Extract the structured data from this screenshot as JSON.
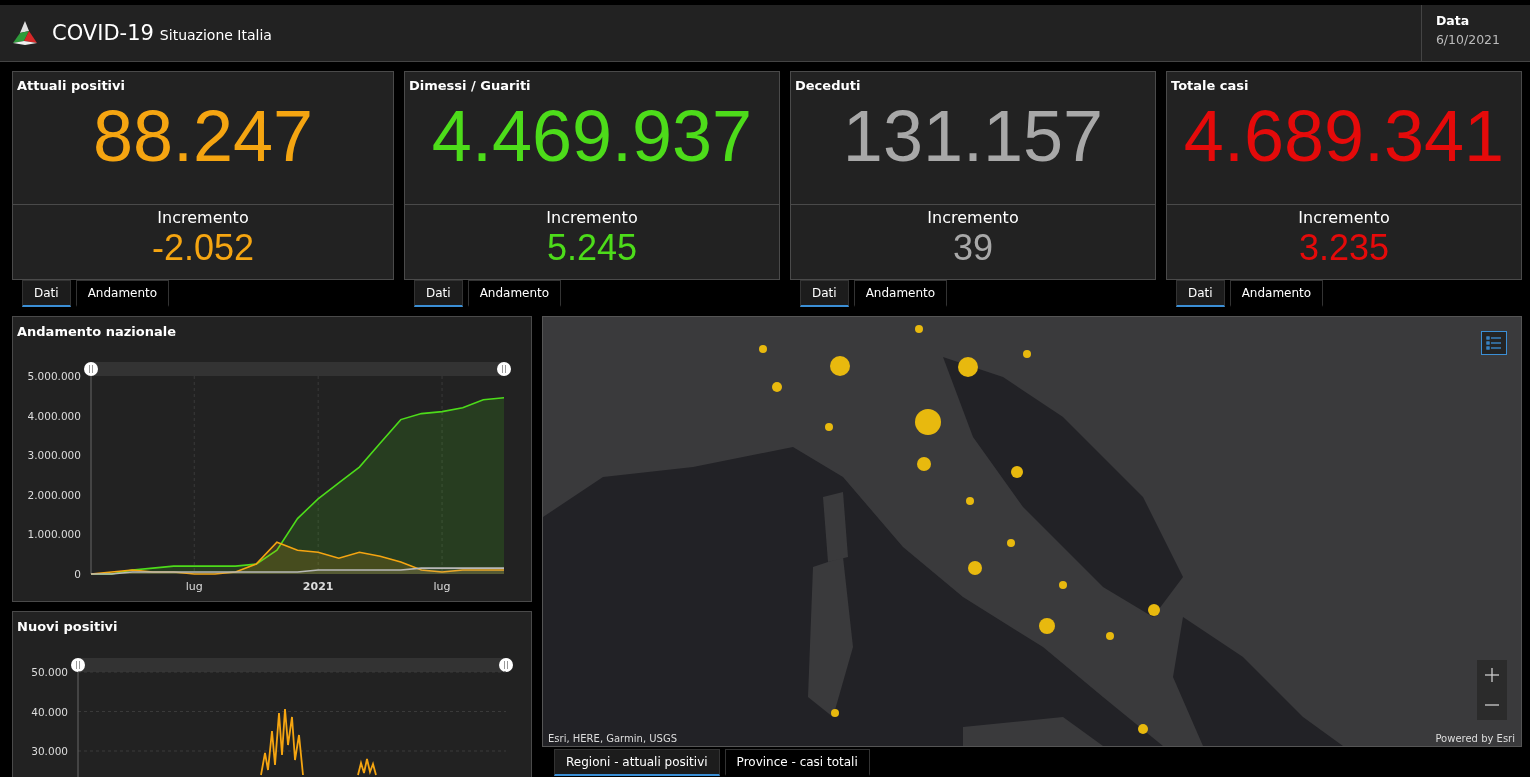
{
  "header": {
    "title": "COVID-19",
    "subtitle": "Situazione Italia",
    "date_label": "Data",
    "date_value": "6/10/2021"
  },
  "cards": [
    {
      "title": "Attuali positivi",
      "value": "88.247",
      "increment_label": "Incremento",
      "increment": "-2.052",
      "color": "#f5a511",
      "tabs": [
        {
          "label": "Dati",
          "selected": true
        },
        {
          "label": "Andamento",
          "selected": false
        }
      ]
    },
    {
      "title": "Dimessi / Guariti",
      "value": "4.469.937",
      "increment_label": "Incremento",
      "increment": "5.245",
      "color": "#4ddc1a",
      "tabs": [
        {
          "label": "Dati",
          "selected": true
        },
        {
          "label": "Andamento",
          "selected": false
        }
      ]
    },
    {
      "title": "Deceduti",
      "value": "131.157",
      "increment_label": "Incremento",
      "increment": "39",
      "color": "#a8a8a8",
      "tabs": [
        {
          "label": "Dati",
          "selected": true
        },
        {
          "label": "Andamento",
          "selected": false
        }
      ]
    },
    {
      "title": "Totale casi",
      "value": "4.689.341",
      "increment_label": "Incremento",
      "increment": "3.235",
      "color": "#e50a0a",
      "tabs": [
        {
          "label": "Dati",
          "selected": true
        },
        {
          "label": "Andamento",
          "selected": false
        }
      ]
    }
  ],
  "national_chart": {
    "title": "Andamento nazionale",
    "chart_data": {
      "type": "area",
      "categories": [
        null,
        null,
        null,
        null,
        null,
        "lug",
        null,
        null,
        null,
        null,
        null,
        "2021",
        null,
        null,
        null,
        null,
        null,
        "lug",
        null,
        null,
        null
      ],
      "ylim": [
        0,
        5000000
      ],
      "grid": true,
      "yticks": [
        0,
        {
          "value": 1000000,
          "label": "1.000.000"
        },
        {
          "value": 2000000,
          "label": "2.000.000"
        },
        {
          "value": 3000000,
          "label": "3.000.000"
        },
        {
          "value": 4000000,
          "label": "4.000.000"
        },
        {
          "value": 5000000,
          "label": "5.000.000"
        }
      ],
      "series": [
        {
          "color": "#4ddc1a",
          "values": [
            0,
            0,
            100000,
            150000,
            200000,
            200000,
            200000,
            200000,
            250000,
            600000,
            1400000,
            1900000,
            2300000,
            2700000,
            3300000,
            3900000,
            4050000,
            4100000,
            4200000,
            4400000,
            4450000
          ]
        },
        {
          "color": "#f5a511",
          "values": [
            0,
            50000,
            100000,
            50000,
            50000,
            0,
            0,
            50000,
            250000,
            800000,
            600000,
            550000,
            400000,
            550000,
            450000,
            300000,
            100000,
            50000,
            100000,
            100000,
            100000
          ]
        },
        {
          "color": "#b8b8b8",
          "values": [
            0,
            0,
            50000,
            50000,
            50000,
            50000,
            50000,
            50000,
            50000,
            50000,
            50000,
            100000,
            100000,
            100000,
            100000,
            100000,
            150000,
            150000,
            150000,
            150000,
            150000
          ]
        }
      ]
    }
  },
  "new_cases_chart": {
    "title": "Nuovi positivi",
    "y_axis_labels": [
      "50.000",
      "40.000",
      "30.000"
    ]
  },
  "map": {
    "attribution": "Esri, HERE, Garmin, USGS",
    "powered_by": "Powered by Esri",
    "tabs": [
      {
        "label": "Regioni - attuali positivi",
        "selected": true
      },
      {
        "label": "Province - casi totali",
        "selected": false
      }
    ]
  }
}
